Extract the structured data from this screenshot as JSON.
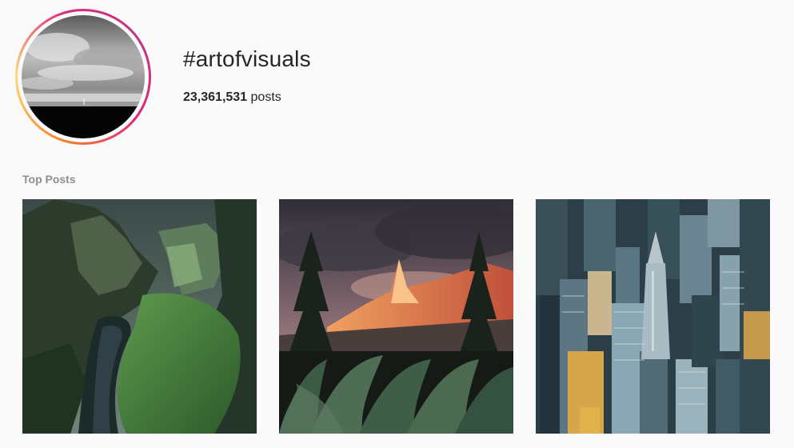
{
  "header": {
    "title": "#artofvisuals",
    "post_count": "23,361,531",
    "post_count_suffix": " posts",
    "avatar_ring_colors": [
      "#f58529",
      "#dd2a7b",
      "#c13584"
    ]
  },
  "top_posts": {
    "label": "Top Posts",
    "items": [
      {
        "subject": "green mossy canyon with river"
      },
      {
        "subject": "sunlit mountain peak with pine trees and leafy foreground"
      },
      {
        "subject": "aerial city skyline with art-deco skyscraper"
      }
    ]
  }
}
